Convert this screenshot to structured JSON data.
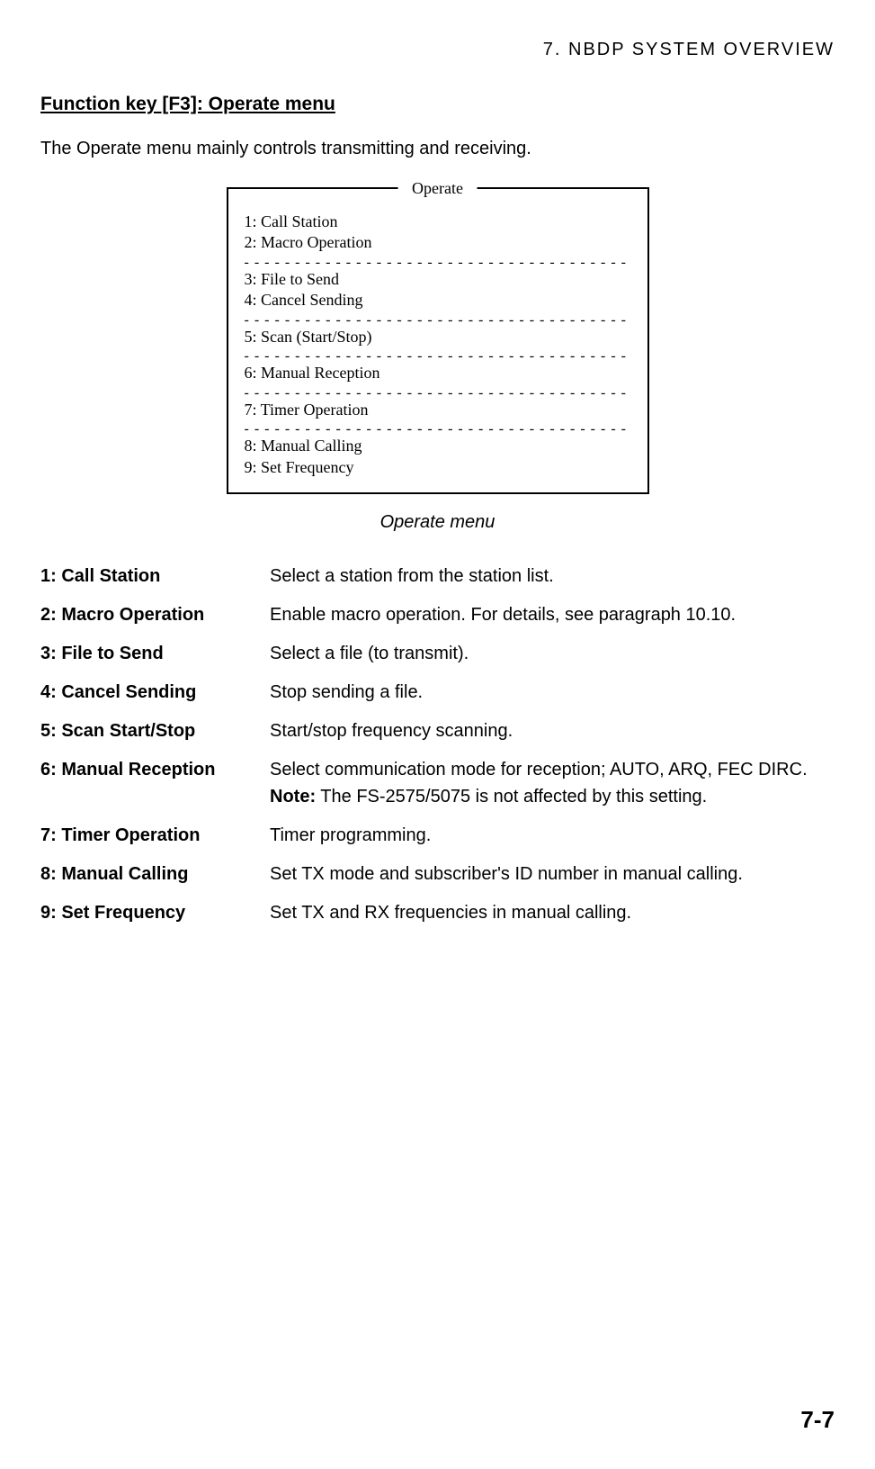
{
  "header": "7.  NBDP  SYSTEM  OVERVIEW",
  "section_title": "Function key [F3]: Operate menu",
  "intro": "The Operate menu mainly controls transmitting and receiving.",
  "menu": {
    "title": "Operate",
    "items": {
      "i1": "1: Call Station",
      "i2": "2: Macro Operation",
      "i3": "3: File to Send",
      "i4": "4: Cancel Sending",
      "i5": "5: Scan (Start/Stop)",
      "i6": "6: Manual Reception",
      "i7": "7: Timer Operation",
      "i8": "8: Manual Calling",
      "i9": "9: Set Frequency"
    }
  },
  "caption": "Operate menu",
  "defs": [
    {
      "term": "1: Call Station",
      "desc": "Select a station from the station list."
    },
    {
      "term": "2: Macro Operation",
      "desc": "Enable macro operation. For details, see paragraph 10.10."
    },
    {
      "term": "3: File to Send",
      "desc": "Select a file (to transmit)."
    },
    {
      "term": "4: Cancel Sending",
      "desc": "Stop sending a file."
    },
    {
      "term": "5: Scan Start/Stop",
      "desc": "Start/stop frequency scanning."
    },
    {
      "term": "6: Manual Reception",
      "desc_a": "Select communication mode for reception; AUTO, ARQ, FEC DIRC.",
      "note_label": "Note:",
      "note_text": " The FS-2575/5075 is not affected by this setting."
    },
    {
      "term": "7: Timer Operation",
      "desc": "Timer programming."
    },
    {
      "term": "8: Manual Calling",
      "desc": "Set TX mode and subscriber's ID number in manual calling."
    },
    {
      "term": "9: Set Frequency",
      "desc": "Set TX and RX frequencies in manual calling."
    }
  ],
  "page_num": "7-7",
  "dashes": "- - - - - - - - - - - - - - - - - - - - - - - - - - - - - - - - - - - - - - - - - - - -"
}
